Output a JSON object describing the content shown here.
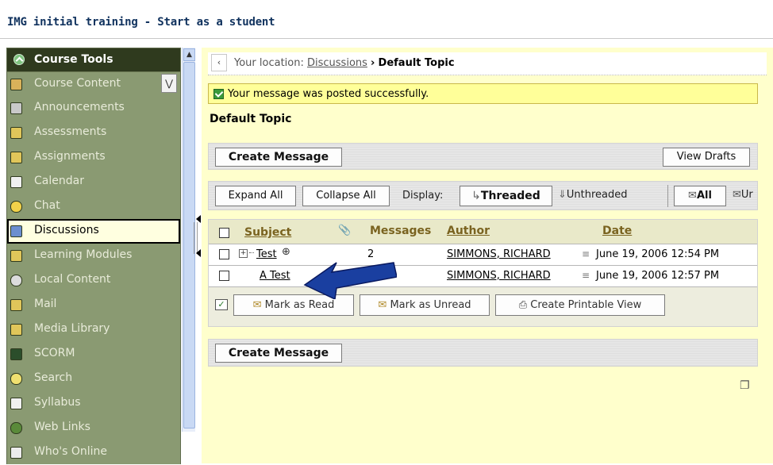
{
  "window": {
    "title": "IMG initial training - Start as a student"
  },
  "sidebar": {
    "header": "Course Tools",
    "items": [
      {
        "label": "Course Content",
        "icon": "house-icon",
        "has_dropdown": true
      },
      {
        "label": "Announcements",
        "icon": "megaphone-icon"
      },
      {
        "label": "Assessments",
        "icon": "assessment-icon"
      },
      {
        "label": "Assignments",
        "icon": "assignment-icon"
      },
      {
        "label": "Calendar",
        "icon": "calendar-icon"
      },
      {
        "label": "Chat",
        "icon": "chat-bubble-icon"
      },
      {
        "label": "Discussions",
        "icon": "pushpin-icon",
        "active": true
      },
      {
        "label": "Learning Modules",
        "icon": "module-icon"
      },
      {
        "label": "Local Content",
        "icon": "disc-icon"
      },
      {
        "label": "Mail",
        "icon": "mail-icon"
      },
      {
        "label": "Media Library",
        "icon": "media-icon"
      },
      {
        "label": "SCORM",
        "icon": "scorm-icon"
      },
      {
        "label": "Search",
        "icon": "magnifier-icon"
      },
      {
        "label": "Syllabus",
        "icon": "syllabus-icon"
      },
      {
        "label": "Web Links",
        "icon": "globe-icon"
      },
      {
        "label": "Who's Online",
        "icon": "person-icon"
      }
    ]
  },
  "breadcrumb": {
    "prefix": "Your location:",
    "link": "Discussions",
    "separator": "›",
    "current": "Default Topic"
  },
  "success_message": "Your message was posted successfully.",
  "topic_title": "Default Topic",
  "toolbar_top": {
    "create": "Create Message",
    "drafts": "View Drafts"
  },
  "toolbar_view": {
    "expand": "Expand All",
    "collapse": "Collapse All",
    "display_label": "Display:",
    "threaded": "Threaded",
    "unthreaded": "Unthreaded",
    "all": "All",
    "unread_partial": "Ur"
  },
  "table": {
    "headers": {
      "subject": "Subject",
      "messages": "Messages",
      "author": "Author",
      "date": "Date"
    },
    "rows": [
      {
        "subject": "Test",
        "messages": "2",
        "author": "SIMMONS, RICHARD",
        "date": "June 19, 2006 12:54 PM",
        "expandable": true
      },
      {
        "subject": "A Test",
        "messages": "",
        "author": "SIMMONS, RICHARD",
        "date": "June 19, 2006 12:57 PM",
        "expandable": false
      }
    ],
    "actions": {
      "mark_read": "Mark as Read",
      "mark_unread": "Mark as Unread",
      "printable": "Create Printable View"
    }
  },
  "toolbar_bottom": {
    "create": "Create Message"
  },
  "colors": {
    "sidebar_bg": "#8a9a72",
    "sidebar_header": "#2f3a1e",
    "content_bg": "#ffffcc",
    "success_bg": "#ffff99",
    "arrow": "#1a3fa0"
  }
}
